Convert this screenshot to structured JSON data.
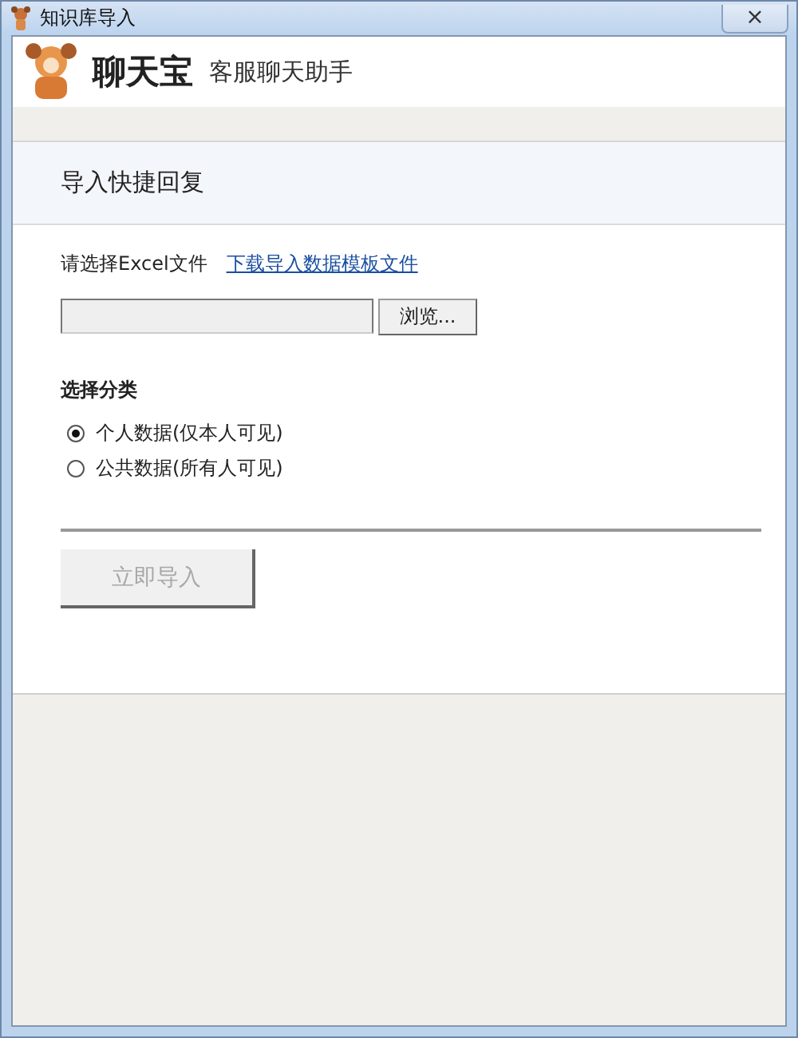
{
  "window": {
    "title": "知识库导入",
    "close": "×"
  },
  "header": {
    "logo_text": "聊天宝",
    "subtitle": "客服聊天助手"
  },
  "section_title": "导入快捷回复",
  "file": {
    "label": "请选择Excel文件",
    "template_link": "下载导入数据模板文件",
    "browse_button": "浏览..."
  },
  "category": {
    "label": "选择分类",
    "options": [
      {
        "label": "个人数据(仅本人可见)",
        "selected": true
      },
      {
        "label": "公共数据(所有人可见)",
        "selected": false
      }
    ]
  },
  "import_button": {
    "label": "立即导入",
    "disabled": true
  }
}
